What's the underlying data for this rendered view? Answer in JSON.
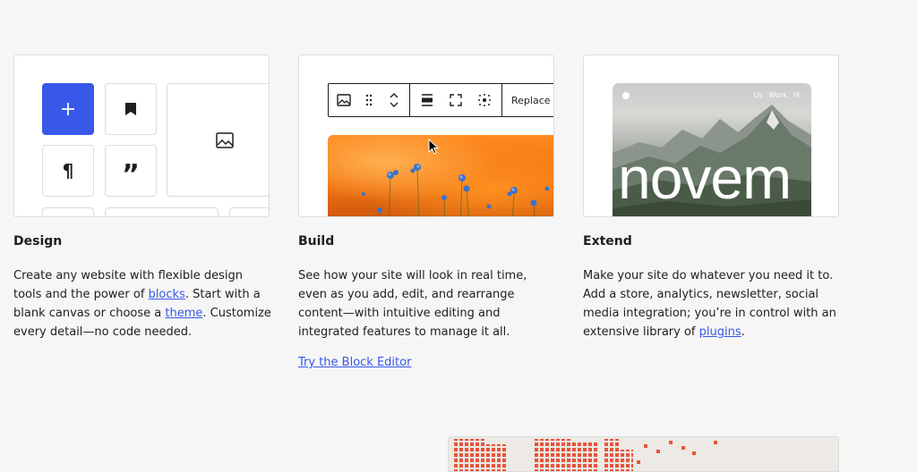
{
  "design": {
    "heading": "Design",
    "text_1": "Create any website with flexible design tools and the power of ",
    "link_blocks": "blocks",
    "text_2": ". Start with a blank canvas or choose a ",
    "link_theme": "theme",
    "text_3": ". Customize every detail—no code needed.",
    "icons": [
      "plus-icon",
      "bookmark-icon",
      "image-icon",
      "pilcrow-icon",
      "quote-icon"
    ],
    "accent": "#3858e9"
  },
  "build": {
    "heading": "Build",
    "text": "See how your site will look in real time, even as you add, edit, and rearrange content—with intuitive editing and integrated features to manage it all.",
    "cta": "Try the Block Editor",
    "toolbar": {
      "replace_label": "Replace",
      "icons": [
        "image-icon",
        "drag-handle-icon",
        "move-up-down-icon",
        "align-icon",
        "fullscreen-icon",
        "focal-point-icon"
      ]
    }
  },
  "extend": {
    "heading": "Extend",
    "text_1": "Make your site do whatever you need it to. Add a store, analytics, newsletter, social media integration; you’re in control with an extensive library of ",
    "link_plugins": "plugins",
    "text_2": ".",
    "site_nav": [
      "Us",
      "Work",
      "Hi"
    ],
    "site_word": "novem"
  }
}
